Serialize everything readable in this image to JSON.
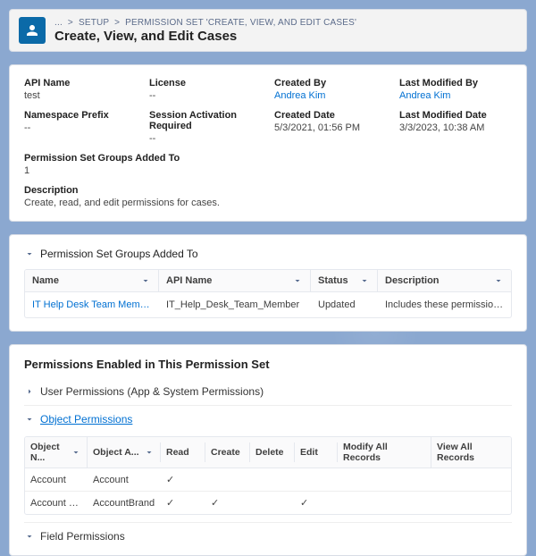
{
  "breadcrumb": {
    "ellipsis": "...",
    "setup": "SETUP",
    "permset": "PERMISSION SET 'CREATE, VIEW, AND EDIT CASES'"
  },
  "page_title": "Create, View, and Edit Cases",
  "details": {
    "api_name_label": "API Name",
    "api_name_value": "test",
    "license_label": "License",
    "license_value": "--",
    "created_by_label": "Created By",
    "created_by_value": "Andrea Kim",
    "last_modified_by_label": "Last Modified By",
    "last_modified_by_value": "Andrea Kim",
    "namespace_prefix_label": "Namespace Prefix",
    "namespace_prefix_value": "--",
    "session_activation_label": "Session Activation Required",
    "session_activation_value": "--",
    "created_date_label": "Created Date",
    "created_date_value": "5/3/2021, 01:56 PM",
    "last_modified_date_label": "Last Modified Date",
    "last_modified_date_value": "3/3/2023, 10:38 AM",
    "groups_added_label": "Permission Set Groups Added To",
    "groups_added_value": "1",
    "description_label": "Description",
    "description_value": "Create, read, and edit permissions for cases."
  },
  "groups_section": {
    "title": "Permission Set Groups Added To",
    "cols": {
      "name": "Name",
      "api_name": "API Name",
      "status": "Status",
      "description": "Description"
    },
    "row": {
      "name": "IT Help Desk Team Member",
      "api_name": "IT_Help_Desk_Team_Member",
      "status": "Updated",
      "description": "Includes these permission sets: View..."
    }
  },
  "perms_section": {
    "title": "Permissions Enabled in This Permission Set",
    "user_perms": "User Permissions (App & System Permissions)",
    "object_perms": "Object Permissions",
    "field_perms": "Field Permissions",
    "obj_cols": {
      "obj_name": "Object N...",
      "obj_api": "Object A...",
      "read": "Read",
      "create": "Create",
      "delete": "Delete",
      "edit": "Edit",
      "modify_all": "Modify All Records",
      "view_all": "View All Records"
    },
    "obj_rows": [
      {
        "name": "Account",
        "api": "Account",
        "read": "✓",
        "create": "",
        "delete": "",
        "edit": "",
        "modify_all": "",
        "view_all": ""
      },
      {
        "name": "Account Brand",
        "api": "AccountBrand",
        "read": "✓",
        "create": "✓",
        "delete": "",
        "edit": "✓",
        "modify_all": "",
        "view_all": ""
      }
    ]
  }
}
